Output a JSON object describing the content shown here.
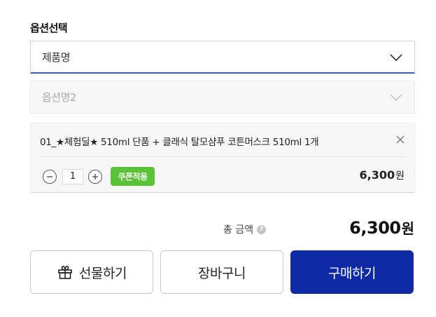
{
  "option_section": {
    "title": "옵션선택",
    "product_select": {
      "label": "제품명",
      "icon": "chevron-down-icon"
    },
    "option_select": {
      "label": "옵션명2",
      "icon": "chevron-down-icon"
    }
  },
  "selected_item": {
    "name": "01_★체험딜★ 510ml 단품 + 클래식 탈모샴푸 코튼머스크 510ml 1개",
    "quantity": "1",
    "coupon_label": "쿠폰적용",
    "price": "6,300",
    "price_unit": "원",
    "colors": {
      "coupon": "#5ac235"
    }
  },
  "total": {
    "label": "총 금액",
    "help_icon": "question-icon",
    "help_glyph": "?",
    "price": "6,300",
    "unit": "원"
  },
  "actions": {
    "gift_label": "선물하기",
    "gift_icon": "gift-icon",
    "cart_label": "장바구니",
    "buy_label": "구매하기",
    "colors": {
      "buy": "#0d2aa4"
    }
  }
}
